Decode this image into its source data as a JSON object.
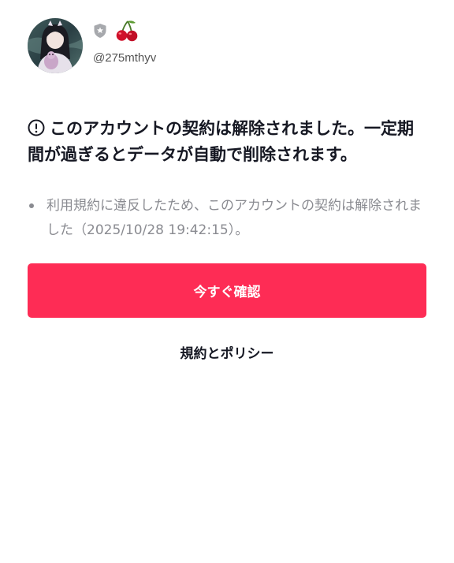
{
  "profile": {
    "avatar_icon": "avatar",
    "badge_icons": [
      "shield-star-icon",
      "cherry-icon"
    ],
    "username": "@275mthyv"
  },
  "notice": {
    "title": "このアカウントの契約は解除されました。一定期間が過ぎるとデータが自動で削除されます。",
    "alert_icon": "alert-circle-icon",
    "details": [
      "利用規約に違反したため、このアカウントの契約は解除されました（2025/10/28 19:42:15）。"
    ]
  },
  "actions": {
    "confirm_label": "今すぐ確認",
    "policy_label": "規約とポリシー"
  },
  "colors": {
    "accent": "#fe2c55",
    "text_primary": "#161823",
    "text_secondary": "#8a8b91",
    "background": "#ffffff"
  }
}
